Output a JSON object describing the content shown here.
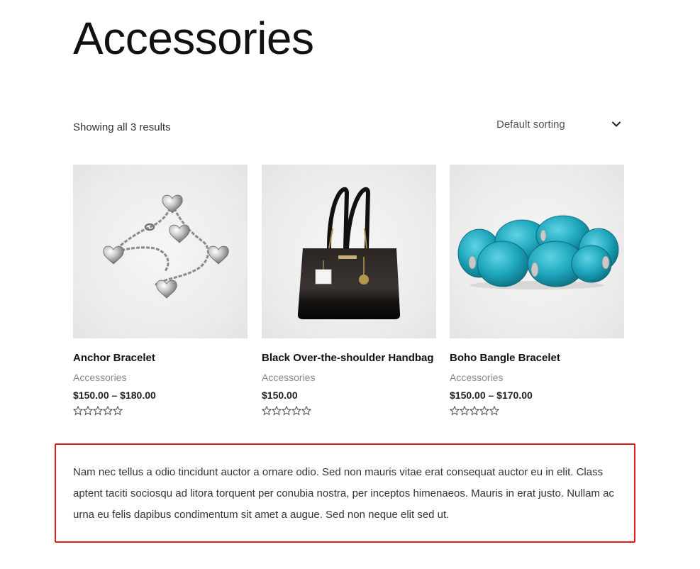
{
  "page": {
    "title": "Accessories",
    "result_count": "Showing all 3 results",
    "sorting": {
      "selected": "Default sorting",
      "icon": "chevron-down-icon"
    }
  },
  "products": [
    {
      "name": "Anchor Bracelet",
      "category": "Accessories",
      "price": "$150.00 – $180.00",
      "rating": 0,
      "image": "silver-heart-charm-bracelet"
    },
    {
      "name": "Black Over-the-shoulder Handbag",
      "category": "Accessories",
      "price": "$150.00",
      "rating": 0,
      "image": "black-handbag"
    },
    {
      "name": "Boho Bangle Bracelet",
      "category": "Accessories",
      "price": "$150.00 – $170.00",
      "rating": 0,
      "image": "turquoise-bangle"
    }
  ],
  "description": "Nam nec tellus a odio tincidunt auctor a ornare odio. Sed non mauris vitae erat consequat auctor eu in elit. Class aptent taciti sociosqu ad litora torquent per conubia nostra, per inceptos himenaeos. Mauris in erat justo. Nullam ac urna eu felis dapibus condimentum sit amet a augue. Sed non neque elit sed ut.",
  "colors": {
    "highlight_border": "#e41b1b",
    "text": "#111111",
    "muted": "#888888"
  }
}
